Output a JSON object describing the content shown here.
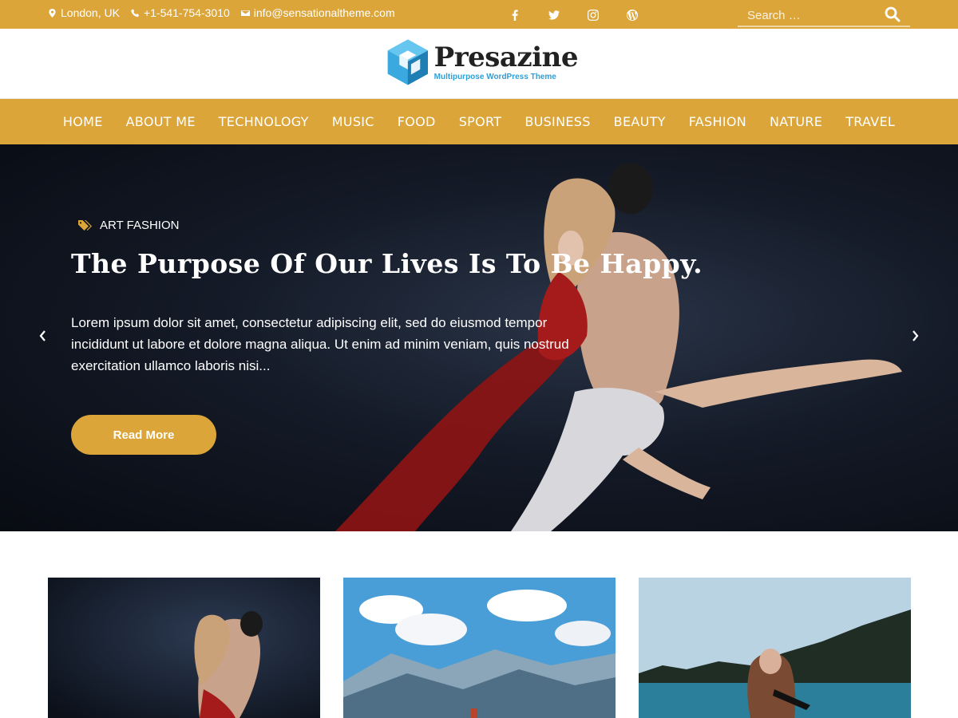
{
  "topbar": {
    "location": "London, UK",
    "phone": "+1-541-754-3010",
    "email": "info@sensationaltheme.com",
    "social": [
      "facebook-icon",
      "twitter-icon",
      "instagram-icon",
      "wordpress-icon"
    ],
    "search_placeholder": "Search …"
  },
  "brand": {
    "name": "Presazine",
    "tagline": "Multipurpose WordPress Theme"
  },
  "nav": [
    "HOME",
    "ABOUT ME",
    "TECHNOLOGY",
    "MUSIC",
    "FOOD",
    "SPORT",
    "BUSINESS",
    "BEAUTY",
    "FASHION",
    "NATURE",
    "TRAVEL"
  ],
  "hero": {
    "category": "ART FASHION",
    "title": "The Purpose Of Our Lives Is To Be Happy.",
    "excerpt": "Lorem ipsum dolor sit amet, consectetur adipiscing elit, sed do eiusmod tempor incididunt ut labore et dolore magna aliqua. Ut enim ad minim veniam, quis nostrud exercitation ullamco laboris nisi...",
    "button": "Read More"
  },
  "colors": {
    "accent": "#dba539",
    "brand_blue": "#2f9fd6"
  }
}
